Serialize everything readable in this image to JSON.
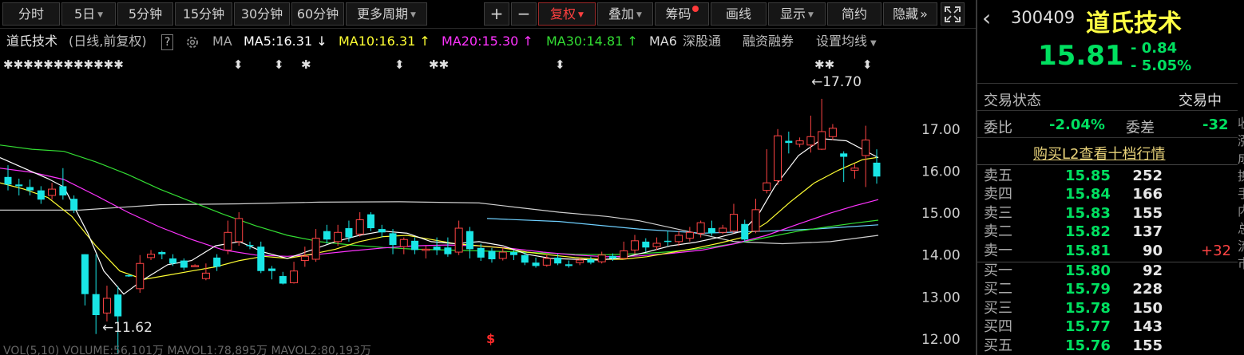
{
  "toolbar": {
    "periods": [
      {
        "label": "分时",
        "left": 0,
        "w": 0
      },
      {
        "label": "5日"
      },
      {
        "label": "5分钟"
      },
      {
        "label": "15分钟"
      },
      {
        "label": "30分钟"
      },
      {
        "label": "60分钟"
      },
      {
        "label": "更多周期"
      }
    ],
    "zoom_in": "+",
    "zoom_out": "−",
    "fuquan": "复权",
    "diejia": "叠加",
    "chouma": "筹码",
    "huaxian": "画线",
    "xianshi": "显示",
    "jianyue": "简约",
    "yincang": "隐藏",
    "yincang_icon": "»"
  },
  "legend": {
    "name": "道氏技术",
    "mode": "(日线,前复权)",
    "help": "?",
    "ma_label": "MA",
    "ma5": "MA5:16.31",
    "ma10": "MA10:16.31",
    "ma20": "MA20:15.30",
    "ma30": "MA30:14.81",
    "ma60": "MA6",
    "up_arrow": "↑",
    "down_arrow": "↓",
    "shenguto": "深股通",
    "rongzi": "融资融券",
    "shezhi": "设置均线"
  },
  "colors": {
    "up": "#ff4444",
    "down": "#19e5e5",
    "ma5": "#ffffff",
    "ma10": "#ffff33",
    "ma20": "#ff33ff",
    "ma30": "#33dd33",
    "ma60": "#d0d0d0",
    "ma_long": "#6fd0ff",
    "price_green": "#00e060"
  },
  "chart_data": {
    "type": "candlestick",
    "ylim": [
      11.6,
      18.8
    ],
    "y_ticks": [
      "17.00",
      "16.00",
      "15.00",
      "14.00",
      "13.00",
      "12.00"
    ],
    "y_tick_values": [
      17,
      16,
      15,
      14,
      13,
      12
    ],
    "high_label": "←17.70",
    "low_label": "←11.62",
    "high_value": 17.7,
    "low_value": 11.62,
    "event_marker": "$",
    "star_marks_left": "✱✱✱✱✱✱✱✱✱✱✱✱",
    "markers": [
      {
        "x": 292,
        "glyph": "⬍"
      },
      {
        "x": 343,
        "glyph": "⬍"
      },
      {
        "x": 377,
        "glyph": "✱"
      },
      {
        "x": 494,
        "glyph": "⬍"
      },
      {
        "x": 537,
        "glyph": "✱✱"
      },
      {
        "x": 695,
        "glyph": "⬍"
      },
      {
        "x": 1020,
        "glyph": "✱✱"
      },
      {
        "x": 1080,
        "glyph": "⬍"
      }
    ],
    "candles": [
      [
        15.84,
        15.66,
        16.12,
        15.52
      ],
      [
        15.66,
        15.62,
        15.8,
        15.4
      ],
      [
        15.6,
        15.52,
        15.78,
        15.4
      ],
      [
        15.52,
        15.3,
        15.62,
        15.2
      ],
      [
        15.4,
        15.55,
        15.7,
        15.3
      ],
      [
        15.62,
        15.4,
        16.05,
        15.3
      ],
      [
        15.32,
        15.05,
        15.4,
        14.98
      ],
      [
        14.0,
        13.05,
        14.0,
        12.78
      ],
      [
        13.05,
        12.55,
        14.0,
        12.1
      ],
      [
        12.6,
        12.95,
        13.25,
        12.4
      ],
      [
        13.04,
        12.52,
        13.24,
        11.62
      ],
      [
        13.5,
        13.48,
        13.52,
        13.46
      ],
      [
        13.18,
        13.78,
        13.98,
        13.08
      ],
      [
        13.92,
        14.0,
        14.1,
        13.86
      ],
      [
        14.05,
        14.0,
        14.08,
        13.88
      ],
      [
        13.9,
        13.78,
        14.0,
        13.72
      ],
      [
        13.85,
        13.68,
        13.9,
        13.62
      ],
      [
        13.72,
        13.73,
        13.76,
        13.7
      ],
      [
        13.42,
        13.55,
        13.78,
        13.38
      ],
      [
        13.92,
        13.7,
        14.0,
        13.6
      ],
      [
        14.1,
        14.52,
        14.8,
        14.0
      ],
      [
        14.3,
        14.85,
        15.0,
        14.2
      ],
      [
        14.22,
        14.2,
        14.3,
        14.12
      ],
      [
        14.18,
        13.6,
        14.3,
        13.55
      ],
      [
        13.66,
        13.6,
        13.72,
        13.4
      ],
      [
        13.48,
        13.3,
        13.58,
        13.28
      ],
      [
        13.32,
        13.6,
        13.82,
        13.3
      ],
      [
        13.85,
        13.95,
        14.18,
        13.7
      ],
      [
        13.88,
        14.38,
        14.6,
        13.82
      ],
      [
        14.55,
        14.35,
        14.7,
        14.25
      ],
      [
        14.3,
        14.52,
        14.7,
        14.2
      ],
      [
        14.62,
        14.4,
        14.8,
        14.3
      ],
      [
        14.48,
        14.82,
        15.0,
        14.42
      ],
      [
        14.95,
        14.62,
        15.0,
        14.55
      ],
      [
        14.6,
        14.52,
        14.7,
        14.4
      ],
      [
        14.5,
        14.22,
        14.6,
        14.0
      ],
      [
        14.18,
        14.35,
        14.4,
        14.0
      ],
      [
        14.32,
        14.1,
        14.4,
        14.0
      ],
      [
        14.1,
        14.12,
        14.2,
        13.9
      ],
      [
        14.18,
        14.1,
        14.4,
        13.98
      ],
      [
        14.16,
        14.0,
        14.4,
        13.94
      ],
      [
        14.05,
        14.62,
        14.8,
        13.98
      ],
      [
        14.55,
        14.12,
        14.65,
        13.9
      ],
      [
        14.15,
        13.92,
        14.25,
        13.84
      ],
      [
        14.08,
        13.88,
        14.15,
        13.8
      ],
      [
        13.9,
        14.05,
        14.15,
        13.85
      ],
      [
        14.05,
        13.98,
        14.1,
        13.86
      ],
      [
        13.98,
        13.8,
        14.04,
        13.74
      ],
      [
        13.8,
        13.72,
        13.92,
        13.68
      ],
      [
        13.74,
        13.9,
        14.0,
        13.7
      ],
      [
        13.92,
        13.78,
        14.0,
        13.74
      ],
      [
        13.76,
        13.72,
        13.85,
        13.68
      ],
      [
        13.8,
        13.86,
        13.92,
        13.74
      ],
      [
        13.88,
        13.8,
        13.94,
        13.76
      ],
      [
        13.82,
        13.98,
        14.06,
        13.78
      ],
      [
        13.96,
        13.9,
        14.02,
        13.84
      ],
      [
        13.9,
        14.08,
        14.3,
        13.88
      ],
      [
        14.1,
        14.32,
        14.46,
        14.0
      ],
      [
        14.3,
        14.16,
        14.38,
        14.06
      ],
      [
        14.18,
        14.26,
        14.4,
        14.1
      ],
      [
        14.32,
        14.3,
        14.56,
        14.2
      ],
      [
        14.3,
        14.45,
        14.56,
        14.2
      ],
      [
        14.38,
        14.52,
        14.65,
        14.3
      ],
      [
        14.5,
        14.75,
        14.8,
        14.4
      ],
      [
        14.62,
        14.5,
        14.8,
        14.44
      ],
      [
        14.52,
        14.62,
        14.7,
        14.48
      ],
      [
        14.55,
        14.95,
        15.2,
        14.5
      ],
      [
        14.72,
        14.35,
        14.82,
        14.3
      ],
      [
        14.55,
        15.06,
        15.32,
        14.5
      ],
      [
        15.52,
        15.7,
        16.5,
        15.45
      ],
      [
        15.75,
        16.82,
        16.98,
        15.65
      ],
      [
        16.7,
        16.65,
        16.92,
        16.4
      ],
      [
        16.62,
        16.7,
        16.78,
        16.55
      ],
      [
        16.6,
        16.8,
        17.3,
        16.42
      ],
      [
        16.5,
        16.92,
        17.7,
        16.48
      ],
      [
        16.8,
        17.0,
        17.1,
        16.72
      ],
      [
        16.4,
        16.32,
        16.45,
        15.72
      ],
      [
        16.0,
        16.05,
        16.15,
        15.8
      ],
      [
        16.35,
        16.72,
        17.06,
        15.6
      ],
      [
        16.18,
        15.85,
        16.5,
        15.68
      ]
    ],
    "ma5": [
      [
        0,
        16.3
      ],
      [
        30,
        16.05
      ],
      [
        60,
        15.8
      ],
      [
        80,
        15.6
      ],
      [
        110,
        14.5
      ],
      [
        130,
        13.6
      ],
      [
        155,
        13.05
      ],
      [
        180,
        13.4
      ],
      [
        210,
        13.75
      ],
      [
        240,
        13.85
      ],
      [
        270,
        14.2
      ],
      [
        300,
        14.3
      ],
      [
        330,
        14.05
      ],
      [
        360,
        13.9
      ],
      [
        390,
        14.1
      ],
      [
        420,
        14.3
      ],
      [
        450,
        14.45
      ],
      [
        480,
        14.55
      ],
      [
        510,
        14.5
      ],
      [
        540,
        14.3
      ],
      [
        570,
        14.25
      ],
      [
        600,
        14.3
      ],
      [
        630,
        14.2
      ],
      [
        660,
        14.0
      ],
      [
        690,
        13.9
      ],
      [
        720,
        13.88
      ],
      [
        750,
        13.86
      ],
      [
        780,
        13.92
      ],
      [
        810,
        14.05
      ],
      [
        840,
        14.2
      ],
      [
        870,
        14.28
      ],
      [
        900,
        14.4
      ],
      [
        930,
        14.55
      ],
      [
        950,
        14.95
      ],
      [
        970,
        15.6
      ],
      [
        1000,
        16.35
      ],
      [
        1030,
        16.75
      ],
      [
        1060,
        16.7
      ],
      [
        1100,
        16.3
      ]
    ],
    "ma10": [
      [
        0,
        15.7
      ],
      [
        30,
        15.55
      ],
      [
        60,
        15.35
      ],
      [
        90,
        14.9
      ],
      [
        120,
        14.2
      ],
      [
        150,
        13.6
      ],
      [
        180,
        13.4
      ],
      [
        210,
        13.5
      ],
      [
        240,
        13.6
      ],
      [
        270,
        13.7
      ],
      [
        300,
        13.85
      ],
      [
        330,
        13.95
      ],
      [
        360,
        13.9
      ],
      [
        390,
        14.0
      ],
      [
        420,
        14.12
      ],
      [
        450,
        14.3
      ],
      [
        480,
        14.42
      ],
      [
        510,
        14.45
      ],
      [
        540,
        14.35
      ],
      [
        570,
        14.25
      ],
      [
        600,
        14.2
      ],
      [
        630,
        14.15
      ],
      [
        660,
        14.05
      ],
      [
        690,
        13.98
      ],
      [
        720,
        13.92
      ],
      [
        750,
        13.88
      ],
      [
        780,
        13.88
      ],
      [
        810,
        13.94
      ],
      [
        840,
        14.04
      ],
      [
        870,
        14.14
      ],
      [
        900,
        14.26
      ],
      [
        930,
        14.4
      ],
      [
        960,
        14.75
      ],
      [
        990,
        15.25
      ],
      [
        1020,
        15.7
      ],
      [
        1050,
        16.0
      ],
      [
        1080,
        16.25
      ],
      [
        1100,
        16.31
      ]
    ],
    "ma20": [
      [
        0,
        16.05
      ],
      [
        40,
        15.95
      ],
      [
        80,
        15.78
      ],
      [
        120,
        15.4
      ],
      [
        160,
        15.0
      ],
      [
        200,
        14.65
      ],
      [
        240,
        14.35
      ],
      [
        280,
        14.1
      ],
      [
        320,
        13.98
      ],
      [
        360,
        13.95
      ],
      [
        400,
        14.0
      ],
      [
        440,
        14.08
      ],
      [
        480,
        14.15
      ],
      [
        520,
        14.2
      ],
      [
        560,
        14.22
      ],
      [
        600,
        14.2
      ],
      [
        640,
        14.14
      ],
      [
        680,
        14.05
      ],
      [
        720,
        13.98
      ],
      [
        760,
        13.94
      ],
      [
        800,
        13.96
      ],
      [
        840,
        14.02
      ],
      [
        880,
        14.1
      ],
      [
        920,
        14.25
      ],
      [
        960,
        14.45
      ],
      [
        1000,
        14.72
      ],
      [
        1040,
        14.98
      ],
      [
        1070,
        15.15
      ],
      [
        1100,
        15.3
      ]
    ],
    "ma30": [
      [
        0,
        16.6
      ],
      [
        40,
        16.5
      ],
      [
        80,
        16.45
      ],
      [
        120,
        16.2
      ],
      [
        160,
        15.9
      ],
      [
        200,
        15.55
      ],
      [
        240,
        15.25
      ],
      [
        280,
        14.95
      ],
      [
        320,
        14.68
      ],
      [
        360,
        14.45
      ],
      [
        400,
        14.3
      ],
      [
        440,
        14.22
      ],
      [
        480,
        14.16
      ],
      [
        520,
        14.12
      ],
      [
        560,
        14.1
      ],
      [
        600,
        14.08
      ],
      [
        640,
        14.06
      ],
      [
        680,
        14.03
      ],
      [
        720,
        14.0
      ],
      [
        760,
        13.99
      ],
      [
        800,
        14.01
      ],
      [
        840,
        14.06
      ],
      [
        880,
        14.14
      ],
      [
        920,
        14.25
      ],
      [
        960,
        14.4
      ],
      [
        1000,
        14.55
      ],
      [
        1040,
        14.66
      ],
      [
        1070,
        14.74
      ],
      [
        1100,
        14.81
      ]
    ],
    "ma60": [
      [
        0,
        15.05
      ],
      [
        100,
        15.05
      ],
      [
        200,
        15.18
      ],
      [
        300,
        15.2
      ],
      [
        400,
        15.24
      ],
      [
        500,
        15.25
      ],
      [
        600,
        15.22
      ],
      [
        700,
        15.0
      ],
      [
        760,
        14.9
      ],
      [
        800,
        14.8
      ],
      [
        860,
        14.55
      ],
      [
        920,
        14.3
      ],
      [
        980,
        14.25
      ],
      [
        1040,
        14.3
      ],
      [
        1100,
        14.45
      ]
    ],
    "ma_long": [
      [
        610,
        14.85
      ],
      [
        700,
        14.78
      ],
      [
        800,
        14.6
      ],
      [
        880,
        14.5
      ],
      [
        960,
        14.55
      ],
      [
        1020,
        14.6
      ],
      [
        1060,
        14.65
      ],
      [
        1100,
        14.7
      ]
    ]
  },
  "bottom_strip": "VOL(5,10)  VOLUME:56,101万  MAVOL1:78,895万  MAVOL2:80,193万",
  "side": {
    "back_icon": "‹",
    "code": "300409",
    "name": "道氏技术",
    "price": "15.81",
    "change": "- 0.84",
    "change_pct": "- 5.05%",
    "trade_status_label": "交易状态",
    "trade_status_value": "交易中",
    "weibi_label": "委比",
    "weibi_value": "-2.04%",
    "weicha_label": "委差",
    "weicha_value": "-32",
    "l2_link": "购买L2查看十档行情",
    "sells": [
      {
        "label": "卖五",
        "price": "15.85",
        "vol": "252",
        "chg": ""
      },
      {
        "label": "卖四",
        "price": "15.84",
        "vol": "166",
        "chg": ""
      },
      {
        "label": "卖三",
        "price": "15.83",
        "vol": "155",
        "chg": ""
      },
      {
        "label": "卖二",
        "price": "15.82",
        "vol": "137",
        "chg": ""
      },
      {
        "label": "卖一",
        "price": "15.81",
        "vol": "90",
        "chg": "+32"
      }
    ],
    "buys": [
      {
        "label": "买一",
        "price": "15.80",
        "vol": "92",
        "chg": ""
      },
      {
        "label": "买二",
        "price": "15.79",
        "vol": "228",
        "chg": ""
      },
      {
        "label": "买三",
        "price": "15.78",
        "vol": "150",
        "chg": ""
      },
      {
        "label": "买四",
        "price": "15.77",
        "vol": "143",
        "chg": ""
      },
      {
        "label": "买五",
        "price": "15.76",
        "vol": "155",
        "chg": ""
      }
    ],
    "strip_chars": [
      "收",
      "涨",
      "成",
      "换",
      "手",
      "内",
      "总",
      "流",
      "市"
    ]
  }
}
